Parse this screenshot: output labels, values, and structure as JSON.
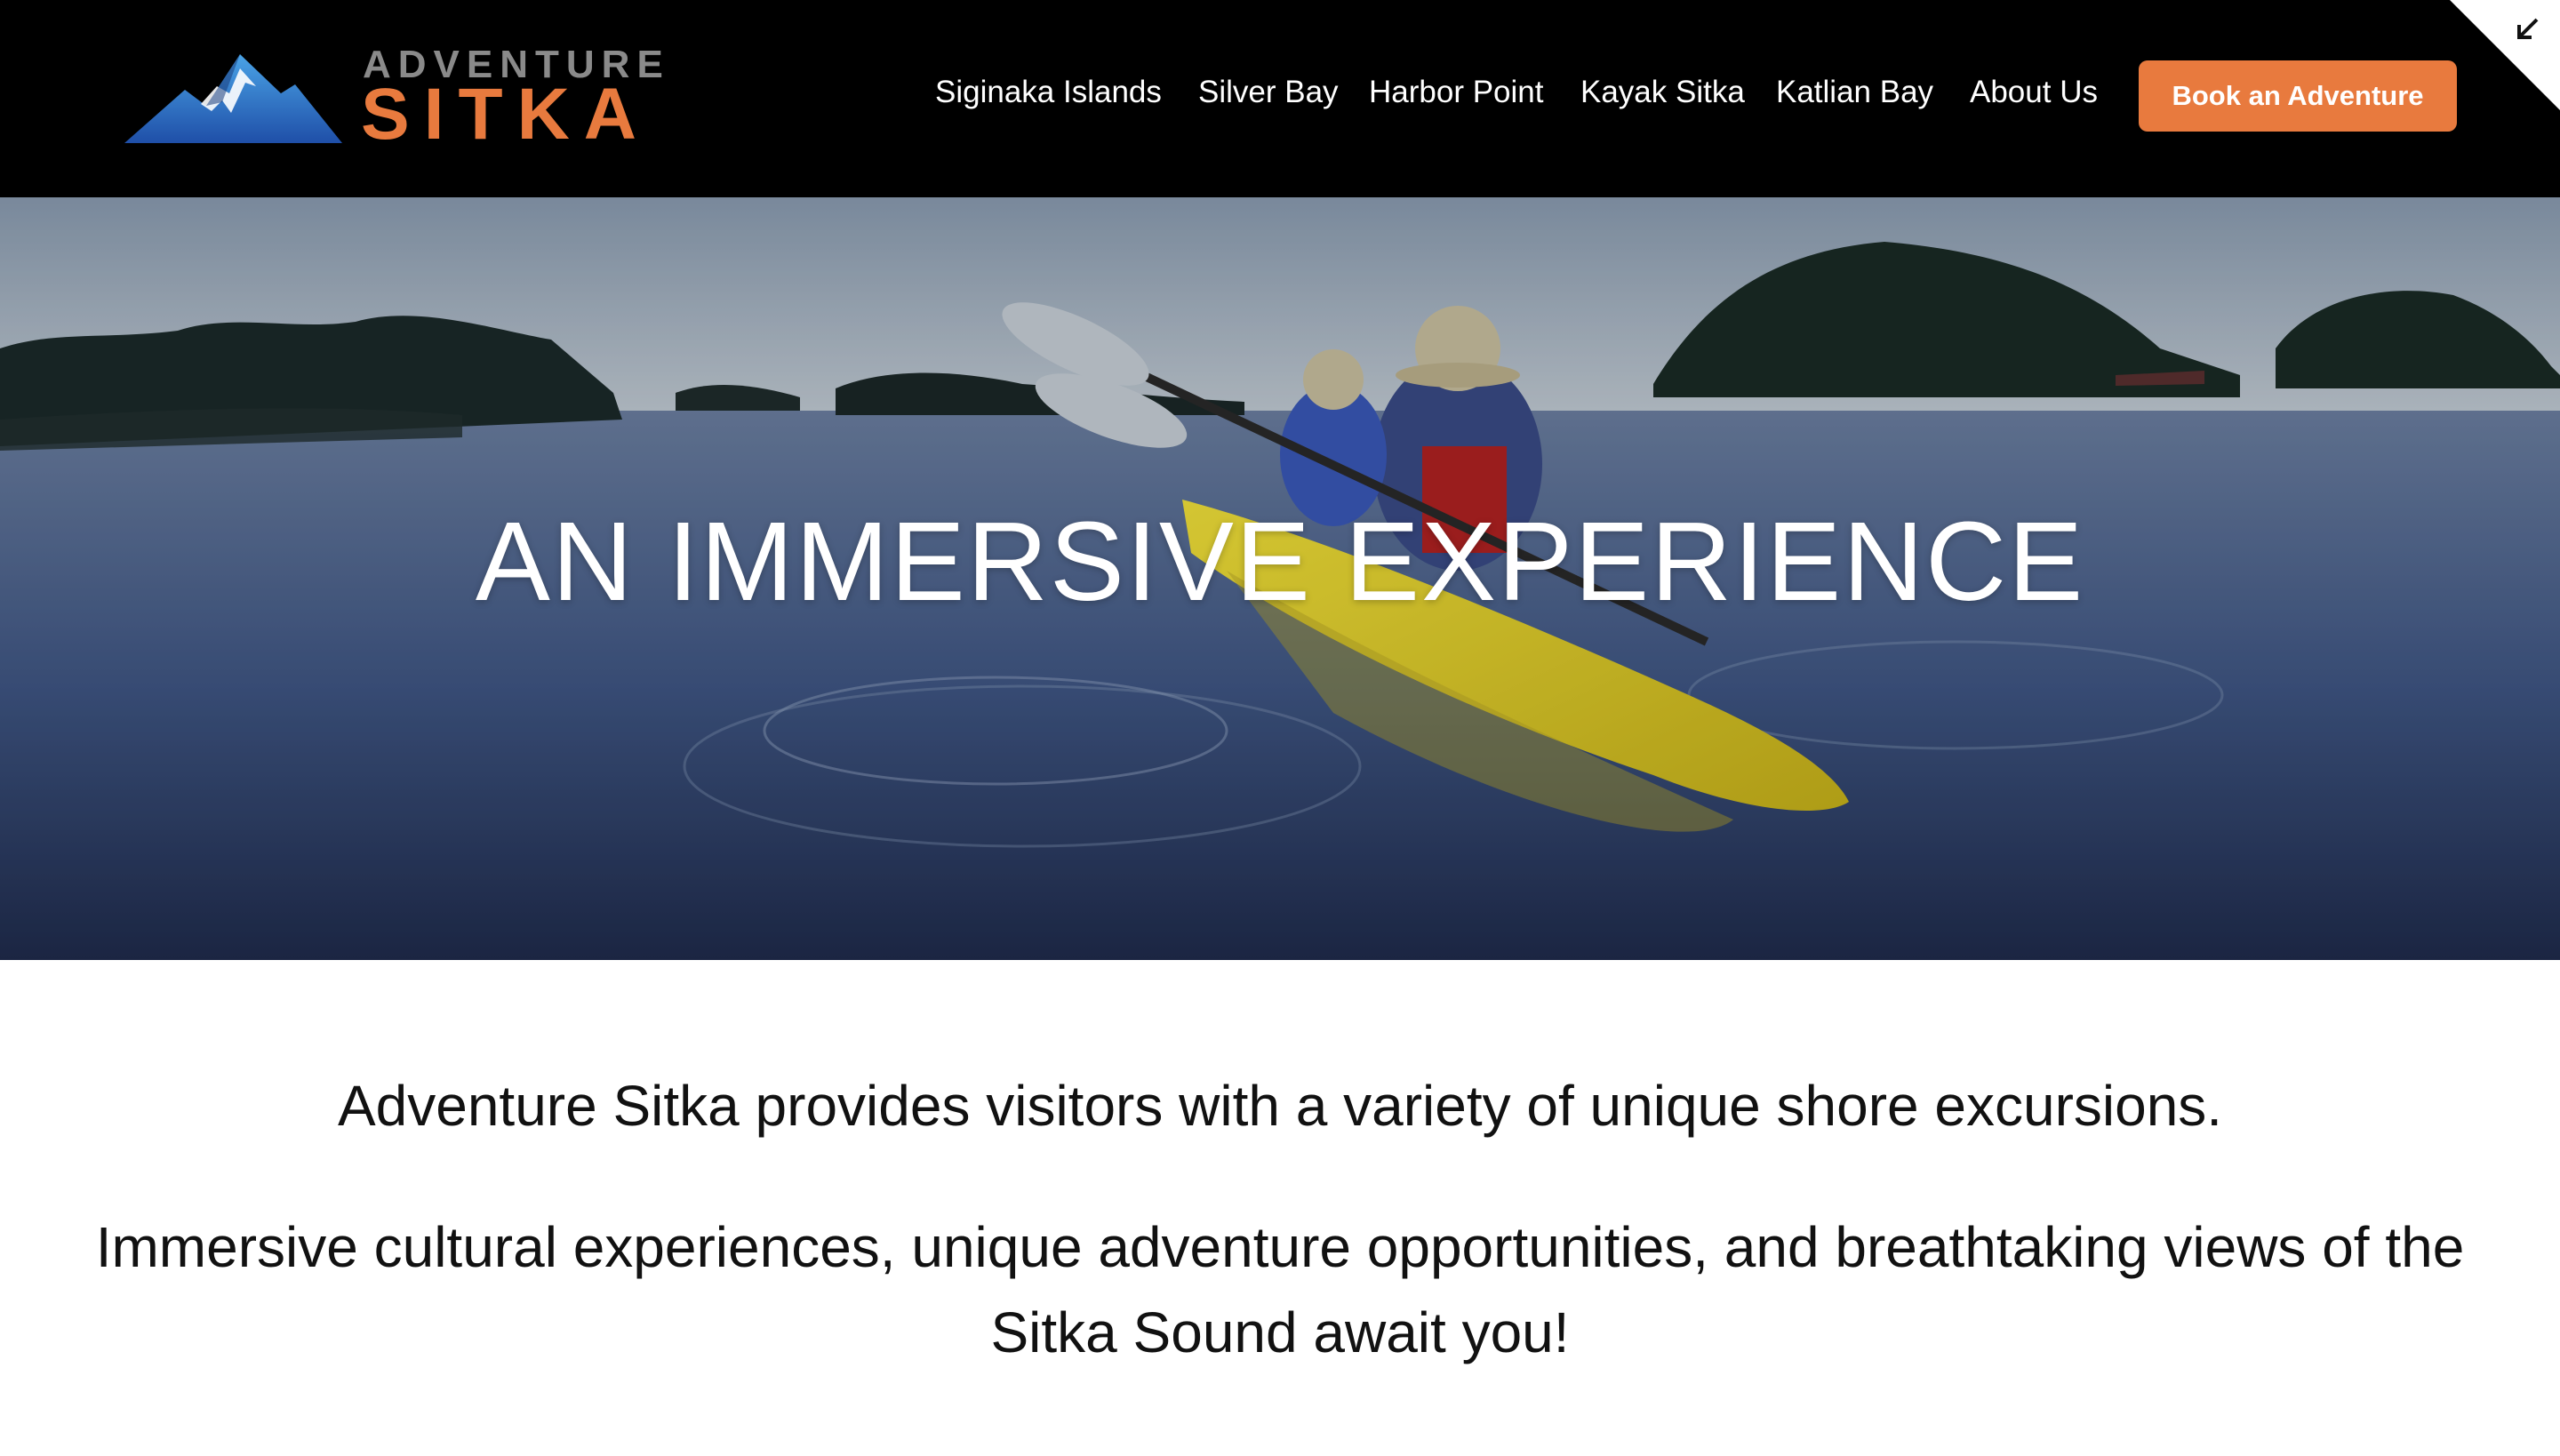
{
  "brand": {
    "logo_top": "ADVENTURE",
    "logo_bottom": "SITKA",
    "accent_color": "#e87a3e",
    "logo_blue": "#2f6fc4"
  },
  "nav": {
    "items": [
      {
        "label": "Siginaka Islands"
      },
      {
        "label": "Silver Bay"
      },
      {
        "label": "Harbor Point"
      },
      {
        "label": "Kayak Sitka"
      },
      {
        "label": "Katlian Bay"
      },
      {
        "label": "About Us"
      }
    ],
    "cta_label": "Book an Adventure"
  },
  "corner": {
    "icon": "arrow-down-left-icon"
  },
  "hero": {
    "title": "AN IMMERSIVE EXPERIENCE",
    "image": "kayakers-yellow-tandem-kayak-calm-water"
  },
  "intro": {
    "paragraph_1": "Adventure Sitka provides visitors with a variety of unique shore excursions.",
    "paragraph_2": "Immersive cultural experiences, unique adventure opportunities, and breathtaking views of the Sitka Sound await you!"
  }
}
